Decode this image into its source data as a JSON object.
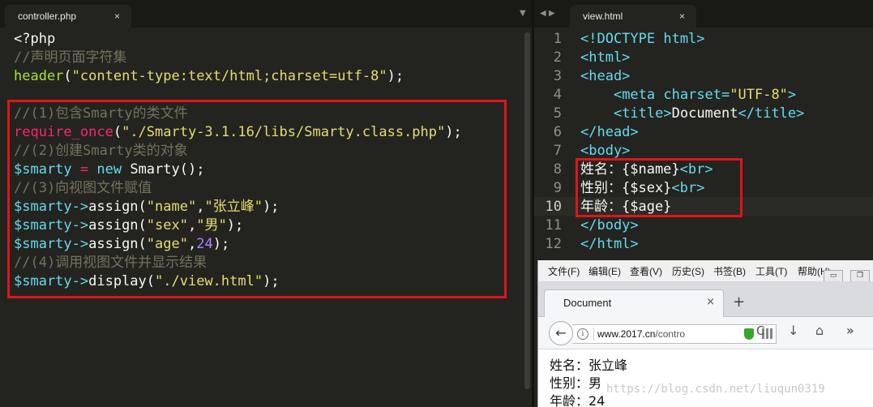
{
  "left_tab": {
    "title": "controller.php",
    "close": "×"
  },
  "right_tab": {
    "title": "view.html",
    "close": "×"
  },
  "tab_controls": {
    "left_dropdown": "▼",
    "nav": "◀ ▶"
  },
  "php_code": [
    [
      {
        "c": "pl",
        "t": "<?php"
      }
    ],
    [
      {
        "c": "cmt",
        "t": "//声明页面字符集"
      }
    ],
    [
      {
        "c": "fn",
        "t": "header"
      },
      {
        "c": "pl",
        "t": "("
      },
      {
        "c": "str",
        "t": "\"content-type:text/html;charset=utf-8\""
      },
      {
        "c": "pl",
        "t": ");"
      }
    ],
    [],
    [
      {
        "c": "cmt",
        "t": "//(1)包含Smarty的类文件"
      }
    ],
    [
      {
        "c": "kw",
        "t": "require_once"
      },
      {
        "c": "pl",
        "t": "("
      },
      {
        "c": "str",
        "t": "\"./Smarty-3.1.16/libs/Smarty.class.php\""
      },
      {
        "c": "pl",
        "t": ");"
      }
    ],
    [
      {
        "c": "cmt",
        "t": "//(2)创建Smarty类的对象"
      }
    ],
    [
      {
        "c": "var",
        "t": "$smarty"
      },
      {
        "c": "kw",
        "t": " = "
      },
      {
        "c": "var",
        "t": "new"
      },
      {
        "c": "pl",
        "t": " Smarty();"
      }
    ],
    [
      {
        "c": "cmt",
        "t": "//(3)向视图文件赋值"
      }
    ],
    [
      {
        "c": "var",
        "t": "$smarty->"
      },
      {
        "c": "pl",
        "t": "assign("
      },
      {
        "c": "str",
        "t": "\"name\""
      },
      {
        "c": "pl",
        "t": ","
      },
      {
        "c": "str",
        "t": "\"张立峰\""
      },
      {
        "c": "pl",
        "t": ");"
      }
    ],
    [
      {
        "c": "var",
        "t": "$smarty->"
      },
      {
        "c": "pl",
        "t": "assign("
      },
      {
        "c": "str",
        "t": "\"sex\""
      },
      {
        "c": "pl",
        "t": ","
      },
      {
        "c": "str",
        "t": "\"男\""
      },
      {
        "c": "pl",
        "t": ");"
      }
    ],
    [
      {
        "c": "var",
        "t": "$smarty->"
      },
      {
        "c": "pl",
        "t": "assign("
      },
      {
        "c": "str",
        "t": "\"age\""
      },
      {
        "c": "pl",
        "t": ","
      },
      {
        "c": "num",
        "t": "24"
      },
      {
        "c": "pl",
        "t": ");"
      }
    ],
    [
      {
        "c": "cmt",
        "t": "//(4)调用视图文件并显示结果"
      }
    ],
    [
      {
        "c": "var",
        "t": "$smarty->"
      },
      {
        "c": "pl",
        "t": "display("
      },
      {
        "c": "str",
        "t": "\"./view.html\""
      },
      {
        "c": "pl",
        "t": ");"
      }
    ]
  ],
  "html_code": [
    {
      "n": "1",
      "parts": [
        {
          "c": "tag",
          "t": "<!DOCTYPE html>"
        }
      ]
    },
    {
      "n": "2",
      "parts": [
        {
          "c": "tag",
          "t": "<html>"
        }
      ]
    },
    {
      "n": "3",
      "parts": [
        {
          "c": "tag",
          "t": "<head>"
        }
      ]
    },
    {
      "n": "4",
      "parts": [
        {
          "c": "pl",
          "t": "    "
        },
        {
          "c": "tag",
          "t": "<meta "
        },
        {
          "c": "attr",
          "t": "charset="
        },
        {
          "c": "str",
          "t": "\"UTF-8\""
        },
        {
          "c": "tag",
          "t": ">"
        }
      ]
    },
    {
      "n": "5",
      "parts": [
        {
          "c": "pl",
          "t": "    "
        },
        {
          "c": "tag",
          "t": "<title>"
        },
        {
          "c": "pl",
          "t": "Document"
        },
        {
          "c": "tag",
          "t": "</title>"
        }
      ]
    },
    {
      "n": "6",
      "parts": [
        {
          "c": "tag",
          "t": "</head>"
        }
      ]
    },
    {
      "n": "7",
      "parts": [
        {
          "c": "tag",
          "t": "<body>"
        }
      ]
    },
    {
      "n": "8",
      "parts": [
        {
          "c": "pl",
          "t": "姓名：{$name}"
        },
        {
          "c": "tag",
          "t": "<br>"
        }
      ]
    },
    {
      "n": "9",
      "parts": [
        {
          "c": "pl",
          "t": "性别：{$sex}"
        },
        {
          "c": "tag",
          "t": "<br>"
        }
      ]
    },
    {
      "n": "10",
      "parts": [
        {
          "c": "pl",
          "t": "年龄：{$age}"
        }
      ]
    },
    {
      "n": "11",
      "parts": [
        {
          "c": "tag",
          "t": "</body>"
        }
      ]
    },
    {
      "n": "12",
      "parts": [
        {
          "c": "tag",
          "t": "</html>"
        }
      ]
    }
  ],
  "colors": {
    "highlight_box": "#e1131c",
    "editor_bg": "#23241f"
  },
  "browser": {
    "menu": [
      "文件(F)",
      "编辑(E)",
      "查看(V)",
      "历史(S)",
      "书签(B)",
      "工具(T)",
      "帮助(H)"
    ],
    "win_min": "▭",
    "win_restore": "❐",
    "tab_title": "Document",
    "tab_close": "×",
    "new_tab": "+",
    "back": "←",
    "info": "i",
    "url_host": "www.2017.cn",
    "url_path": "/contro",
    "reload": "C",
    "download": "↓",
    "home": "⌂",
    "more": "»",
    "output": [
      "姓名：张立峰",
      "性别：男",
      "年龄：24"
    ]
  },
  "watermark": "https://blog.csdn.net/liuqun0319"
}
